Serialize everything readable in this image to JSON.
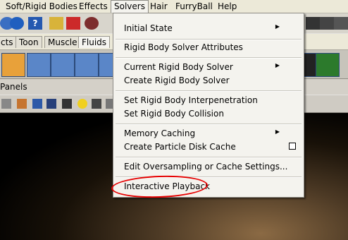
{
  "menubar": {
    "items": [
      "Soft/Rigid Bodies",
      "Effects",
      "Solvers",
      "Hair",
      "FurryBall",
      "Help"
    ],
    "active": "Solvers"
  },
  "shelf_tabs": [
    "cts",
    "Toon",
    "Muscle",
    "Fluids"
  ],
  "panels_label": "Panels",
  "solvers_menu": {
    "items": [
      {
        "label": "Initial State",
        "submenu": true
      },
      {
        "label": "Rigid Body Solver Attributes",
        "submenu": false
      },
      {
        "label": "Current Rigid Body Solver",
        "submenu": true
      },
      {
        "label": "Create Rigid Body Solver",
        "submenu": false
      },
      {
        "label": "Set Rigid Body Interpenetration",
        "submenu": false
      },
      {
        "label": "Set Rigid Body Collision",
        "submenu": false
      },
      {
        "label": "Memory Caching",
        "submenu": true
      },
      {
        "label": "Create Particle Disk Cache",
        "submenu": false,
        "option_box": true
      },
      {
        "label": "Edit Oversampling or Cache Settings...",
        "submenu": false
      },
      {
        "label": "Interactive Playback",
        "submenu": false,
        "highlighted_annotation": true
      }
    ]
  },
  "colors": {
    "annotation": "#e60000",
    "menu_bg": "#f4f3ee"
  }
}
